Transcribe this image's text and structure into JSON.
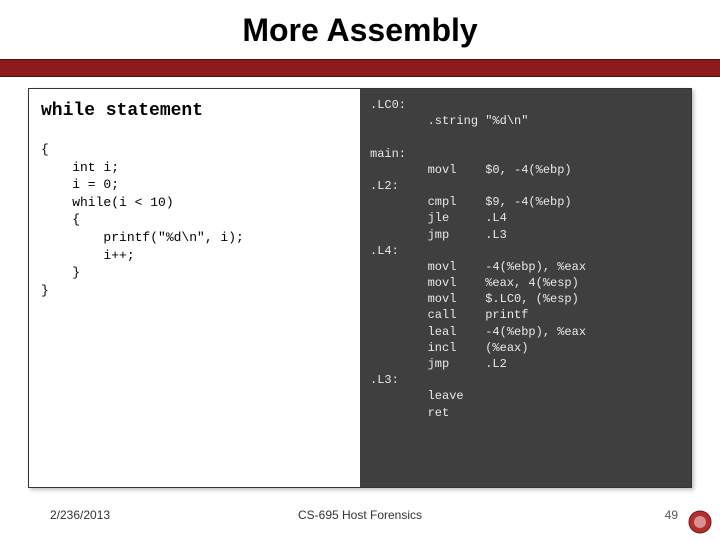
{
  "title": "More Assembly",
  "left": {
    "heading": "while statement",
    "code": "{\n    int i;\n    i = 0;\n    while(i < 10)\n    {\n        printf(\"%d\\n\", i);\n        i++;\n    }\n}"
  },
  "right": {
    "asm": ".LC0:\n        .string \"%d\\n\"\n\nmain:\n        movl    $0, -4(%ebp)\n.L2:\n        cmpl    $9, -4(%ebp)\n        jle     .L4\n        jmp     .L3\n.L4:\n        movl    -4(%ebp), %eax\n        movl    %eax, 4(%esp)\n        movl    $.LC0, (%esp)\n        call    printf\n        leal    -4(%ebp), %eax\n        incl    (%eax)\n        jmp     .L2\n.L3:\n        leave\n        ret"
  },
  "footer": {
    "date": "2/236/2013",
    "course": "CS-695 Host Forensics",
    "page": "49"
  },
  "icons": {
    "seal": "university-seal-icon"
  }
}
